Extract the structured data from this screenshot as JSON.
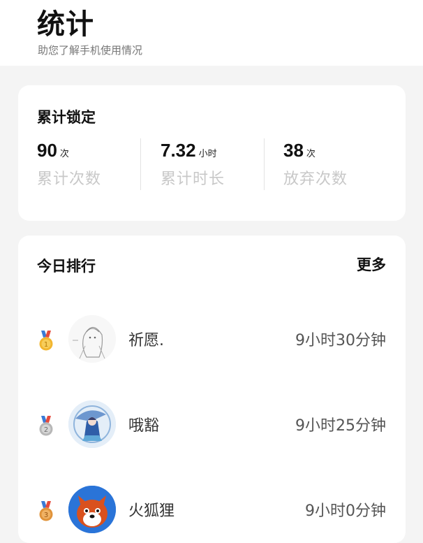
{
  "header": {
    "title": "统计",
    "subtitle": "助您了解手机使用情况"
  },
  "lock_summary": {
    "title": "累计锁定",
    "stats": [
      {
        "value": "90",
        "unit": "次",
        "label": "累计次数"
      },
      {
        "value": "7.32",
        "unit": "小时",
        "label": "累计时长"
      },
      {
        "value": "38",
        "unit": "次",
        "label": "放弃次数"
      }
    ]
  },
  "ranking": {
    "title": "今日排行",
    "more_label": "更多",
    "items": [
      {
        "rank": 1,
        "medal": "gold-medal-icon",
        "avatar": "sketch-girl-avatar",
        "name": "祈愿.",
        "time": "9小时30分钟"
      },
      {
        "rank": 2,
        "medal": "silver-medal-icon",
        "avatar": "umbrella-girl-avatar",
        "name": "哦豁",
        "time": "9小时25分钟"
      },
      {
        "rank": 3,
        "medal": "bronze-medal-icon",
        "avatar": "fox-avatar",
        "name": "火狐狸",
        "time": "9小时0分钟"
      }
    ]
  },
  "colors": {
    "gold": "#f2b630",
    "silver": "#b7b7b7",
    "bronze": "#e0933a",
    "fox_bg": "#2a74d8",
    "fox_orange": "#d9511e"
  }
}
